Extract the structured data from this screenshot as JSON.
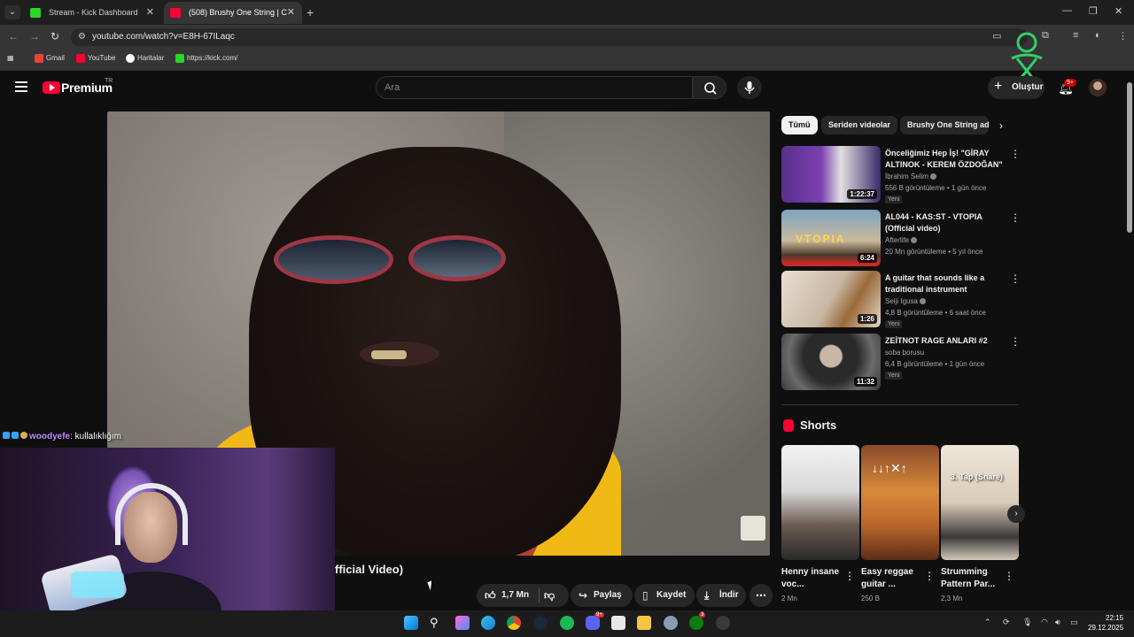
{
  "browser": {
    "tabs": [
      {
        "title": "Stream - Kick Dashboard",
        "favicon": "kick-icon"
      },
      {
        "title": "(508) Brushy One String | C",
        "favicon": "youtube-icon",
        "active": true
      }
    ],
    "url": "youtube.com/watch?v=E8H-67ILaqc",
    "bookmarks": [
      "Gmail",
      "YouTube",
      "Haritalar",
      "https://kick.com/"
    ]
  },
  "youtube": {
    "brand": "Premium",
    "region": "TR",
    "search_placeholder": "Ara",
    "create_label": "Oluştur",
    "notification_count": "9+"
  },
  "overlay": {
    "chat_user": "woodyefe",
    "chat_message": ": kullalıklığım"
  },
  "video": {
    "title_visible": "fficial Video)",
    "likes": "1,7 Mn",
    "share": "Paylaş",
    "save": "Kaydet",
    "download": "İndir"
  },
  "chips": [
    "Tümü",
    "Seriden videolar",
    "Brushy One String ad"
  ],
  "recommendations": [
    {
      "title": "Önceliğimiz Hep İş! \"GİRAY ALTINOK - KEREM ÖZDOĞAN\" ...",
      "channel": "İbrahim Selim",
      "meta": "556 B görüntüleme • 1 gün önce",
      "badge": "Yeni",
      "duration": "1:22:37"
    },
    {
      "title": "AL044 - KAS:ST - VTOPIA (Official video)",
      "channel": "Afterlife",
      "meta": "20 Mn görüntüleme • 5 yıl önce",
      "badge": "",
      "duration": "6:24"
    },
    {
      "title": "A guitar that sounds like a traditional instrument",
      "channel": "Seiji Igusa",
      "meta": "4,8 B görüntüleme • 6 saat önce",
      "badge": "Yeni",
      "duration": "1:26"
    },
    {
      "title": "ZEİTNOT RAGE ANLARI #2",
      "channel": "soba borusu",
      "meta": "6,4 B görüntüleme • 1 gün önce",
      "badge": "Yeni",
      "duration": "11:32"
    }
  ],
  "shorts": {
    "heading": "Shorts",
    "items": [
      {
        "title": "Henny insane voc...",
        "views": "2 Mn"
      },
      {
        "title": "Easy reggae guitar ...",
        "views": "250 B"
      },
      {
        "title": "Strumming Pattern Par...",
        "views": "2,3 Mn",
        "overlay_text": "3. Tap (Snare)"
      }
    ]
  },
  "taskbar": {
    "time": "22:15",
    "date": "29.12.2025"
  }
}
